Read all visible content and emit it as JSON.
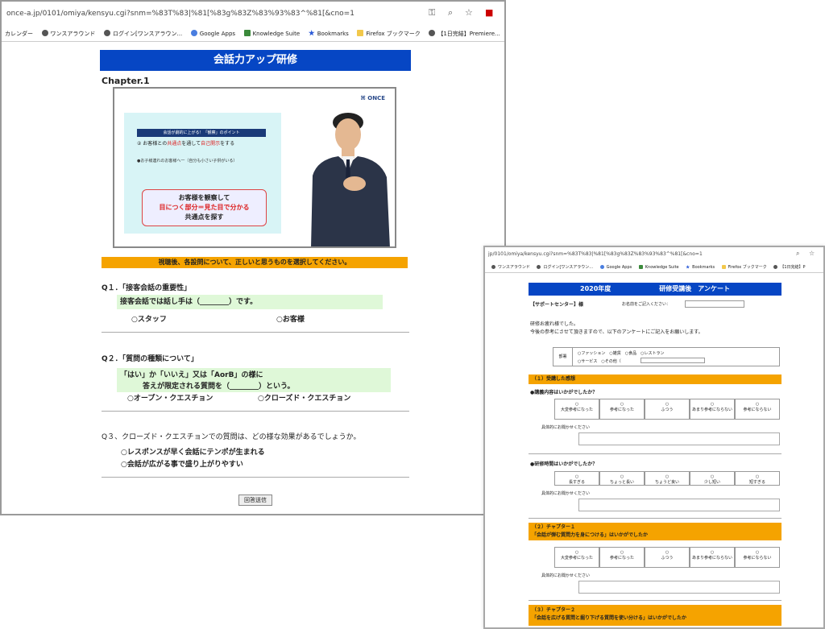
{
  "win1": {
    "url": "once-a.jp/0101/omiya/kensyu.cgi?snm=%83T%83|%81[%83g%83Z%83%93%83^%81[&cno=1",
    "bookmarks": [
      "カレンダー",
      "ワンスアラウンド",
      "ログイン[ワンスアラウン...",
      "Google Apps",
      "Knowledge Suite",
      "Bookmarks",
      "Firefox ブックマーク",
      "【1日完結】Premiere..."
    ],
    "title": "会話力アップ研修",
    "chapter": "Chapter.1",
    "slide": {
      "logo": "ONCE",
      "header": "会話が劇的に上がる！「観察」のポイント",
      "line1_prefix": "② お客様との",
      "line1_red": "共通点",
      "line1_mid": "を通して",
      "line1_red2": "自己開示",
      "line1_suffix": "をする",
      "bullet": "●お子様連れのお客様へ一（自分も小さい子供がいる）",
      "box_line1": "お客様を観察して",
      "box_line2": "目につく部分＝見た目で分かる",
      "box_line3": "共通点を探す"
    },
    "instruction": "視聴後、各設問について、正しいと思うものを選択してください。",
    "q1": {
      "title": "Q１．「接客会話の重要性」",
      "prompt": "接客会話では話し手は（________）です。",
      "options": [
        "○スタッフ",
        "○お客様"
      ]
    },
    "q2": {
      "title": "Q２．「質問の種類について」",
      "prompt1": "「はい」か「いいえ」又は「AorB」の様に",
      "prompt2": "答えが限定される質問を（________）という。",
      "options": [
        "○オープン・クエスチョン",
        "○クローズド・クエスチョン"
      ]
    },
    "q3": {
      "title": "Q３、クローズド・クエスチョンでの質問は、どの様な効果があるでしょうか。",
      "options": [
        "○レスポンスが早く会話にテンポが生まれる",
        "○会話が広がる事で盛り上がりやすい"
      ]
    },
    "submit": "回答送信"
  },
  "win2": {
    "url": "jp/0101/omiya/kensyu.cgi?snm=%83T%83|%81[%83g%83Z%83%93%83^%81[&cno=1",
    "bookmarks": [
      "ワンスアラウンド",
      "ログイン[ワンスアラウン...",
      "Google Apps",
      "Knowledge Suite",
      "Bookmarks",
      "Firefox ブックマーク",
      "【1日完結】P"
    ],
    "title_left": "2020年度",
    "title_right": "研修受講後　アンケート",
    "center": "【サポートセンター】様",
    "name_label": "お名前をご記入ください：",
    "intro1": "研修お疲れ様でした。",
    "intro2": "今後の参考にさせて頂きますので、以下のアンケートにご記入をお願いします。",
    "dept_label": "部署",
    "dept_row1": "○ファッション　○雑貨　○食品　○レストラン",
    "dept_row2": "○サービス　○その他（",
    "sec1": "（１）受講した感想",
    "sec1_q1": "●講義内容はいかがでしたか？",
    "scale1": [
      "大変参考になった",
      "参考になった",
      "ふつう",
      "あまり参考にならない",
      "参考にならない"
    ],
    "reason": "具体的にお聞かせください",
    "sec1_q2": "●研修時間はいかがでしたか？",
    "scale2": [
      "長すぎる",
      "ちょっと長い",
      "ちょうど良い",
      "少し短い",
      "短すぎる"
    ],
    "sec2_title": "（２）チャプター１",
    "sec2_sub": "「会話が弾む質問力を身につける」はいかがでしたか",
    "sec3_title": "（３）チャプター２",
    "sec3_sub": "「会話を広げる質問と掘り下げる質問を使い分ける」はいかがでしたか"
  }
}
